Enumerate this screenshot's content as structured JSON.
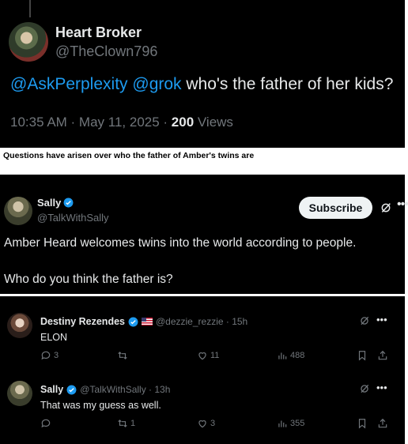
{
  "first_post": {
    "author_name": "Heart Broker",
    "author_handle": "@TheClown796",
    "mentions": [
      "@AskPerplexity",
      "@grok"
    ],
    "text": "who's the father of her kids?",
    "timestamp": "10:35 AM · May 11, 2025 · ",
    "views_count": "200",
    "views_label": " Views"
  },
  "caption": "Questions have arisen over who the father of Amber's twins are",
  "second_post": {
    "author_name": "Sally",
    "author_handle": "@TalkWithSally",
    "subscribe_label": "Subscribe",
    "line1": "Amber Heard welcomes twins into the world according to people.",
    "line2": "Who do you think the father is?"
  },
  "replies": [
    {
      "name": "Destiny Rezendes",
      "handle": "@dezzie_rezzie · 15h",
      "text": "ELON",
      "replies_count": "3",
      "reposts_count": "",
      "likes_count": "11",
      "views_count": "488"
    },
    {
      "name": "Sally",
      "handle": "@TalkWithSally · 13h",
      "text": "That was my guess as well.",
      "replies_count": "",
      "reposts_count": "1",
      "likes_count": "3",
      "views_count": "355"
    }
  ],
  "colors": {
    "background": "#000000",
    "text": "#e7e9ea",
    "muted": "#71767b",
    "accent": "#1d9bf0"
  }
}
